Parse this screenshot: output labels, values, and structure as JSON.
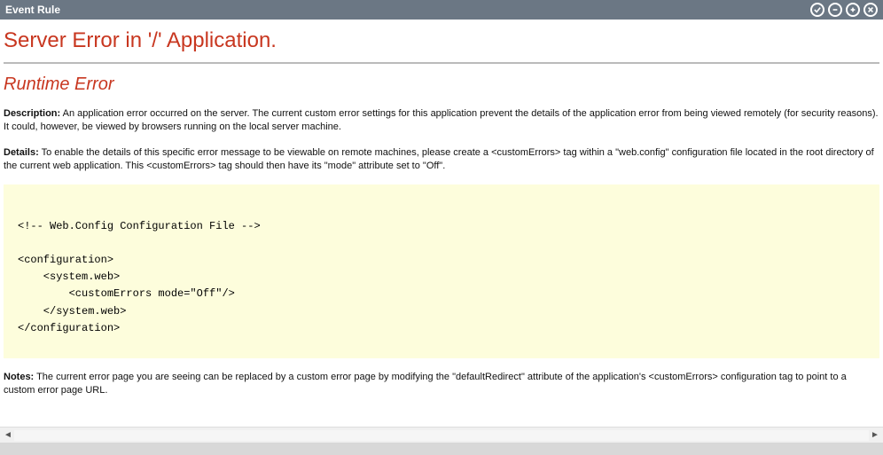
{
  "titlebar": {
    "title": "Event Rule"
  },
  "error": {
    "h1": "Server Error in '/' Application.",
    "h2": "Runtime Error",
    "desc_label": "Description:",
    "desc_text": " An application error occurred on the server. The current custom error settings for this application prevent the details of the application error from being viewed remotely (for security reasons). It could, however, be viewed by browsers running on the local server machine.",
    "details_label": "Details:",
    "details_text": " To enable the details of this specific error message to be viewable on remote machines, please create a <customErrors> tag within a \"web.config\" configuration file located in the root directory of the current web application. This <customErrors> tag should then have its \"mode\" attribute set to \"Off\".",
    "code": "\n<!-- Web.Config Configuration File -->\n\n<configuration>\n    <system.web>\n        <customErrors mode=\"Off\"/>\n    </system.web>\n</configuration>",
    "notes_label": "Notes:",
    "notes_text": " The current error page you are seeing can be replaced by a custom error page by modifying the \"defaultRedirect\" attribute of the application's <customErrors> configuration tag to point to a custom error page URL."
  }
}
